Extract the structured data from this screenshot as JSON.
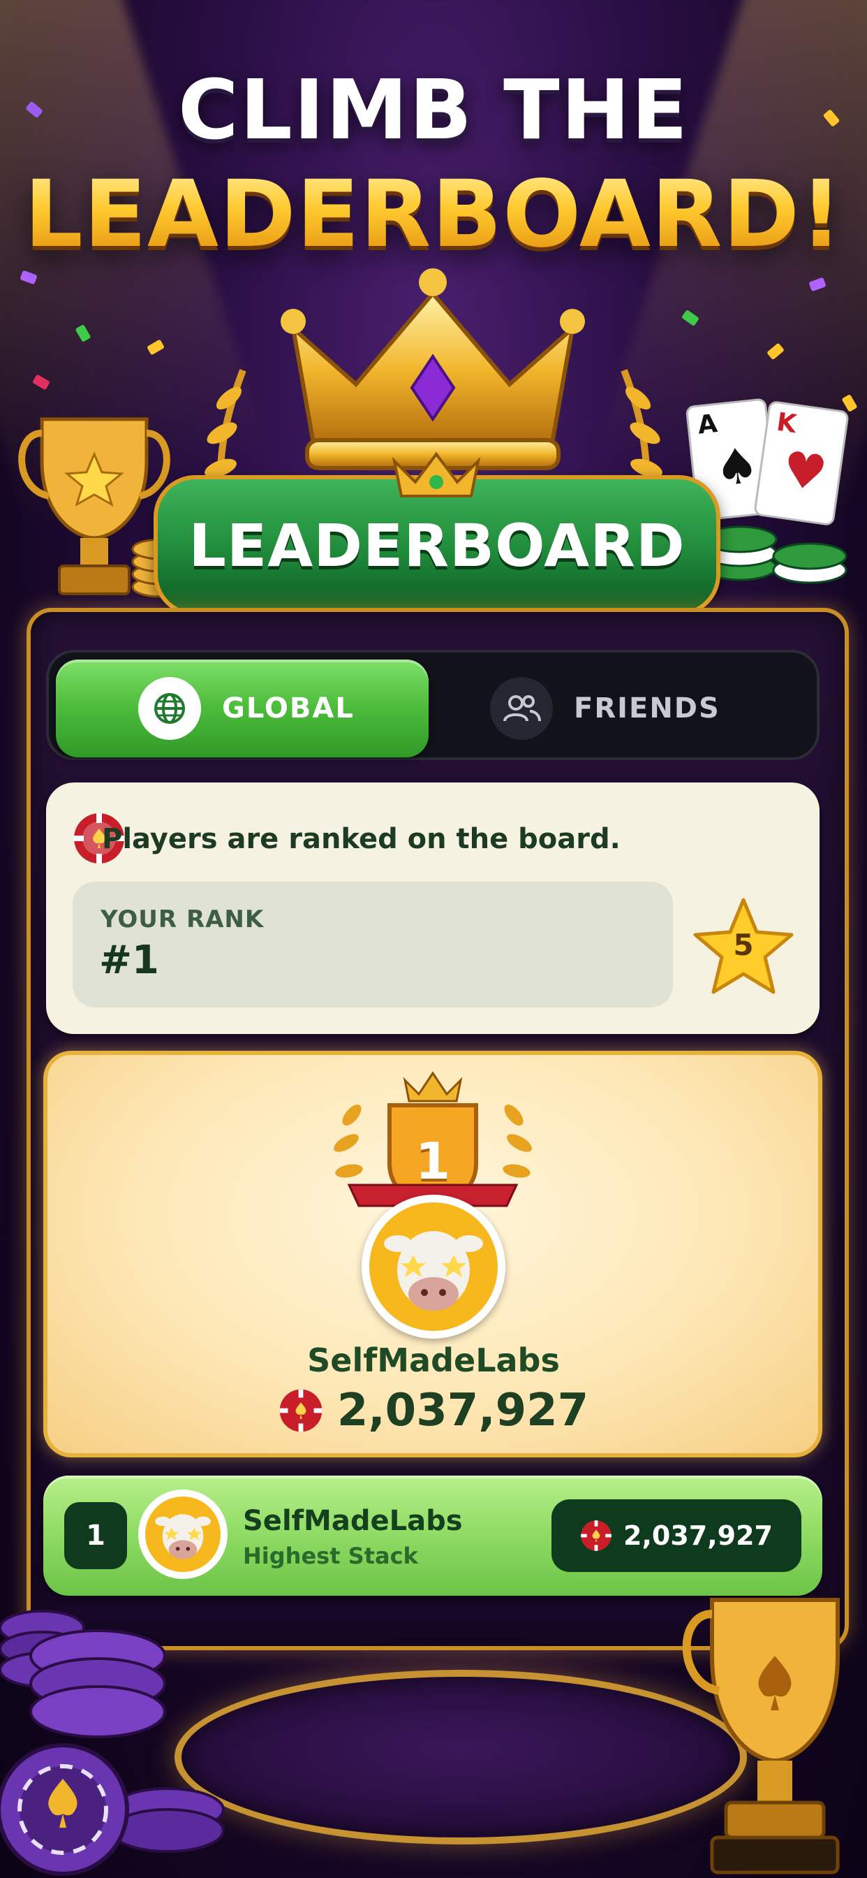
{
  "headline": {
    "line1": "CLIMB THE",
    "line2": "LEADERBOARD!"
  },
  "banner": {
    "label": "LEADERBOARD"
  },
  "cards": {
    "left": {
      "rank": "A",
      "suit": "♠"
    },
    "right": {
      "rank": "K",
      "suit": "♥"
    }
  },
  "tabs": [
    {
      "label": "GLOBAL",
      "icon": "globe-icon",
      "active": true
    },
    {
      "label": "FRIENDS",
      "icon": "friends-icon",
      "active": false
    }
  ],
  "info": {
    "message": "Players are ranked on the board.",
    "your_rank_label": "YOUR RANK",
    "your_rank_value": "#1",
    "star_level": "5"
  },
  "featured": {
    "rank": "1",
    "name": "SelfMadeLabs",
    "score": "2,037,927"
  },
  "list": [
    {
      "rank": "1",
      "name": "SelfMadeLabs",
      "subtitle": "Highest Stack",
      "score": "2,037,927"
    }
  ],
  "colors": {
    "accent_green": "#4cbb3a",
    "gold": "#ffc52a",
    "dark_green": "#0f3a1e",
    "chip_red": "#c81e2a"
  }
}
